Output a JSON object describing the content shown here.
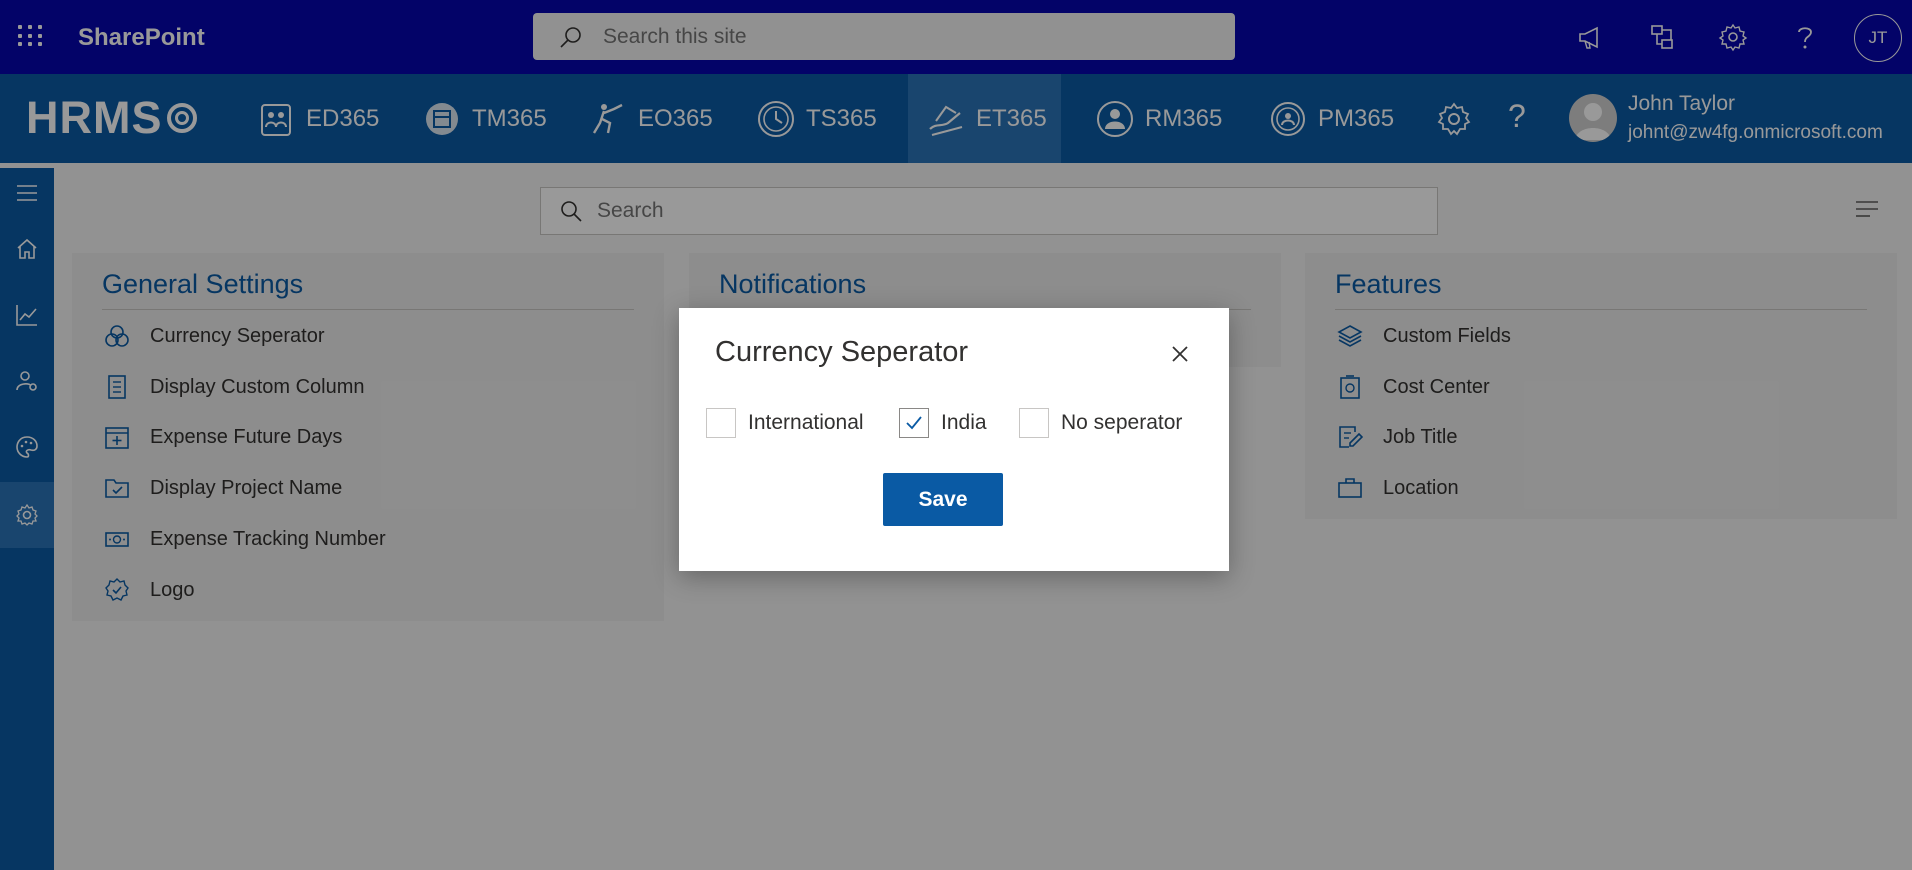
{
  "suite": {
    "app_name": "SharePoint",
    "search_placeholder": "Search this site",
    "user_initials": "JT"
  },
  "hrms_nav": {
    "logo": "HRMS",
    "items": [
      {
        "label": "ED365",
        "icon": "employee-directory-icon"
      },
      {
        "label": "TM365",
        "icon": "task-manager-icon"
      },
      {
        "label": "EO365",
        "icon": "onboarding-icon"
      },
      {
        "label": "TS365",
        "icon": "timesheet-clock-icon"
      },
      {
        "label": "ET365",
        "icon": "expense-tracker-icon",
        "active": true
      },
      {
        "label": "RM365",
        "icon": "resource-user-icon"
      },
      {
        "label": "PM365",
        "icon": "performance-icon"
      }
    ],
    "user_name": "John Taylor",
    "user_email": "johnt@zw4fg.onmicrosoft.com"
  },
  "content": {
    "search_placeholder": "Search"
  },
  "cards": {
    "general": {
      "title": "General Settings",
      "items": [
        {
          "label": "Currency Seperator",
          "icon": "currency-icon"
        },
        {
          "label": "Display Custom Column",
          "icon": "document-list-icon"
        },
        {
          "label": "Expense Future Days",
          "icon": "calendar-add-icon"
        },
        {
          "label": "Display Project Name",
          "icon": "folder-check-icon"
        },
        {
          "label": "Expense Tracking Number",
          "icon": "money-icon"
        },
        {
          "label": "Logo",
          "icon": "badge-check-icon"
        }
      ]
    },
    "notifications": {
      "title": "Notifications"
    },
    "features": {
      "title": "Features",
      "items": [
        {
          "label": "Custom Fields",
          "icon": "layers-icon"
        },
        {
          "label": "Cost Center",
          "icon": "cost-center-icon"
        },
        {
          "label": "Job Title",
          "icon": "edit-document-icon"
        },
        {
          "label": "Location",
          "icon": "briefcase-icon"
        }
      ]
    }
  },
  "dialog": {
    "title": "Currency Seperator",
    "options": [
      {
        "label": "International",
        "checked": false
      },
      {
        "label": "India",
        "checked": true
      },
      {
        "label": "No seperator",
        "checked": false
      }
    ],
    "save_label": "Save"
  },
  "colors": {
    "suite_bar": "#0505ad",
    "hrms_bar": "#0a5aa4",
    "accent": "#0a5aa4"
  }
}
